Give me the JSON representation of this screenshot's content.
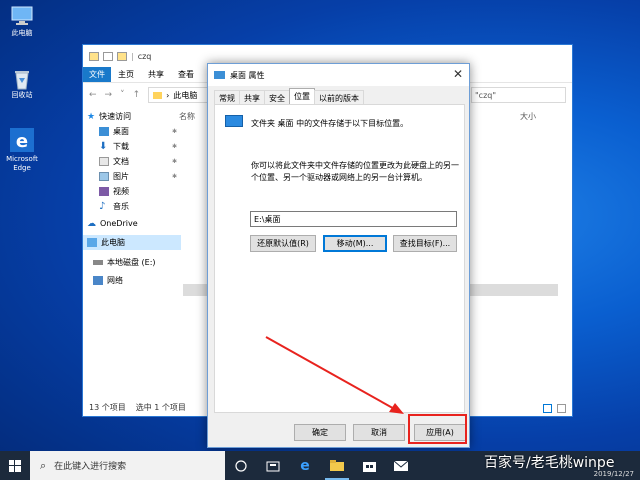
{
  "desktop": {
    "icons": [
      {
        "label": "此电脑",
        "icon": "computer-icon"
      },
      {
        "label": "回收站",
        "icon": "recycle-bin-icon"
      },
      {
        "label": "Microsoft Edge",
        "icon": "edge-icon"
      }
    ]
  },
  "explorer": {
    "title": "czq",
    "ribbon_tabs": [
      "文件",
      "主页",
      "共享",
      "查看"
    ],
    "address": "此电脑",
    "search_placeholder": "\"czq\"",
    "column_name": "名称",
    "column_size": "大小",
    "nav_items": [
      {
        "label": "快速访问",
        "icon": "star-icon"
      },
      {
        "label": "桌面",
        "icon": "desktop-icon",
        "pinned": true
      },
      {
        "label": "下载",
        "icon": "download-icon",
        "pinned": true
      },
      {
        "label": "文档",
        "icon": "document-icon",
        "pinned": true
      },
      {
        "label": "图片",
        "icon": "picture-icon",
        "pinned": true
      },
      {
        "label": "视频",
        "icon": "video-icon"
      },
      {
        "label": "音乐",
        "icon": "music-icon"
      },
      {
        "label": "OneDrive",
        "icon": "cloud-icon"
      },
      {
        "label": "此电脑",
        "icon": "computer-icon",
        "selected": true
      },
      {
        "label": "本地磁盘 (E:)",
        "icon": "drive-icon"
      },
      {
        "label": "网络",
        "icon": "network-icon"
      }
    ],
    "status_count": "13 个项目",
    "status_selected": "选中 1 个项目"
  },
  "dialog": {
    "title": "桌面 属性",
    "tabs": [
      "常规",
      "共享",
      "安全",
      "位置",
      "以前的版本"
    ],
    "active_tab": "位置",
    "description": "文件夹 桌面 中的文件存储于以下目标位置。",
    "explanation": "你可以将此文件夹中文件存储的位置更改为此硬盘上的另一个位置、另一个驱动器或网络上的另一台计算机。",
    "path_value": "E:\\桌面",
    "restore_label": "还原默认值(R)",
    "move_label": "移动(M)...",
    "find_target_label": "查找目标(F)...",
    "ok_label": "确定",
    "cancel_label": "取消",
    "apply_label": "应用(A)"
  },
  "annotation": {
    "arrow_color": "#e8231e",
    "highlight_color": "#e8231e"
  },
  "taskbar": {
    "search_placeholder": "在此键入进行搜索",
    "icons": [
      "task-view-icon",
      "people-icon",
      "edge-icon",
      "file-explorer-icon",
      "store-icon",
      "mail-icon"
    ]
  },
  "watermark": "百家号/老毛桃winpe",
  "clock_date": "2019/12/27"
}
